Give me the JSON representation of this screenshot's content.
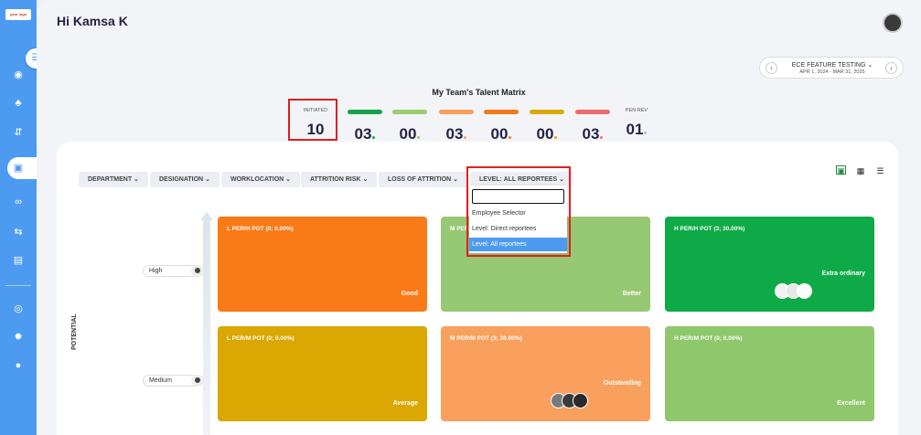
{
  "sidebar": {
    "logo": "your logo",
    "icons": [
      "globe-icon",
      "team-icon",
      "org-chart-icon",
      "matrix-icon",
      "handshake-icon",
      "transfer-icon",
      "report-icon",
      "eye-icon",
      "settings-icon",
      "user-icon"
    ]
  },
  "header": {
    "greeting": "Hi Kamsa K"
  },
  "project": {
    "name": "ECE FEATURE TESTING",
    "dates": "APR 1, 2024 - MAR 31, 2025",
    "prev": "‹",
    "next": "›"
  },
  "matrix_title": "My Team's Talent Matrix",
  "stats": [
    {
      "label": "INITIATED",
      "value": "10",
      "color": ""
    },
    {
      "label": "",
      "value": "03",
      "color": "#12a44a"
    },
    {
      "label": "",
      "value": "00",
      "color": "#9acd72"
    },
    {
      "label": "",
      "value": "03",
      "color": "#f9a05a"
    },
    {
      "label": "",
      "value": "00",
      "color": "#f07a1a"
    },
    {
      "label": "",
      "value": "00",
      "color": "#d9aa06"
    },
    {
      "label": "",
      "value": "03",
      "color": "#f06b6b"
    },
    {
      "label": "PEN REV",
      "value": "01",
      "color": "#bbbbbb"
    }
  ],
  "filters": [
    "DEPARTMENT",
    "DESIGNATION",
    "WORKLOCATION",
    "ATTRITION RISK",
    "LOSS OF ATTRITION",
    "LEVEL: ALL REPORTEES"
  ],
  "level_dropdown": {
    "search_value": "",
    "options": [
      "Employee Selector",
      "Level: Direct reportees",
      "Level: All reportees"
    ],
    "selected": "Level: All reportees"
  },
  "axis": {
    "y_label": "POTENTIAL",
    "rows": [
      "High",
      "Medium"
    ]
  },
  "cells": [
    {
      "title": "L PER/H POT (0; 0.00%)",
      "quality": "Good",
      "color": "#f97a16"
    },
    {
      "title": "M PER/H POT",
      "quality": "Better",
      "color": "#97c873"
    },
    {
      "title": "H PER/H POT (3; 30.00%)",
      "quality": "Extra ordinary",
      "color": "#0faa48"
    },
    {
      "title": "L PER/M POT (0; 0.00%)",
      "quality": "Average",
      "color": "#dba702"
    },
    {
      "title": "M PER/M POT (3; 30.00%)",
      "quality": "Outstanding",
      "color": "#f9a05e"
    },
    {
      "title": "H PER/M POT (0; 0.00%)",
      "quality": "Excellent",
      "color": "#8fc76c"
    }
  ]
}
